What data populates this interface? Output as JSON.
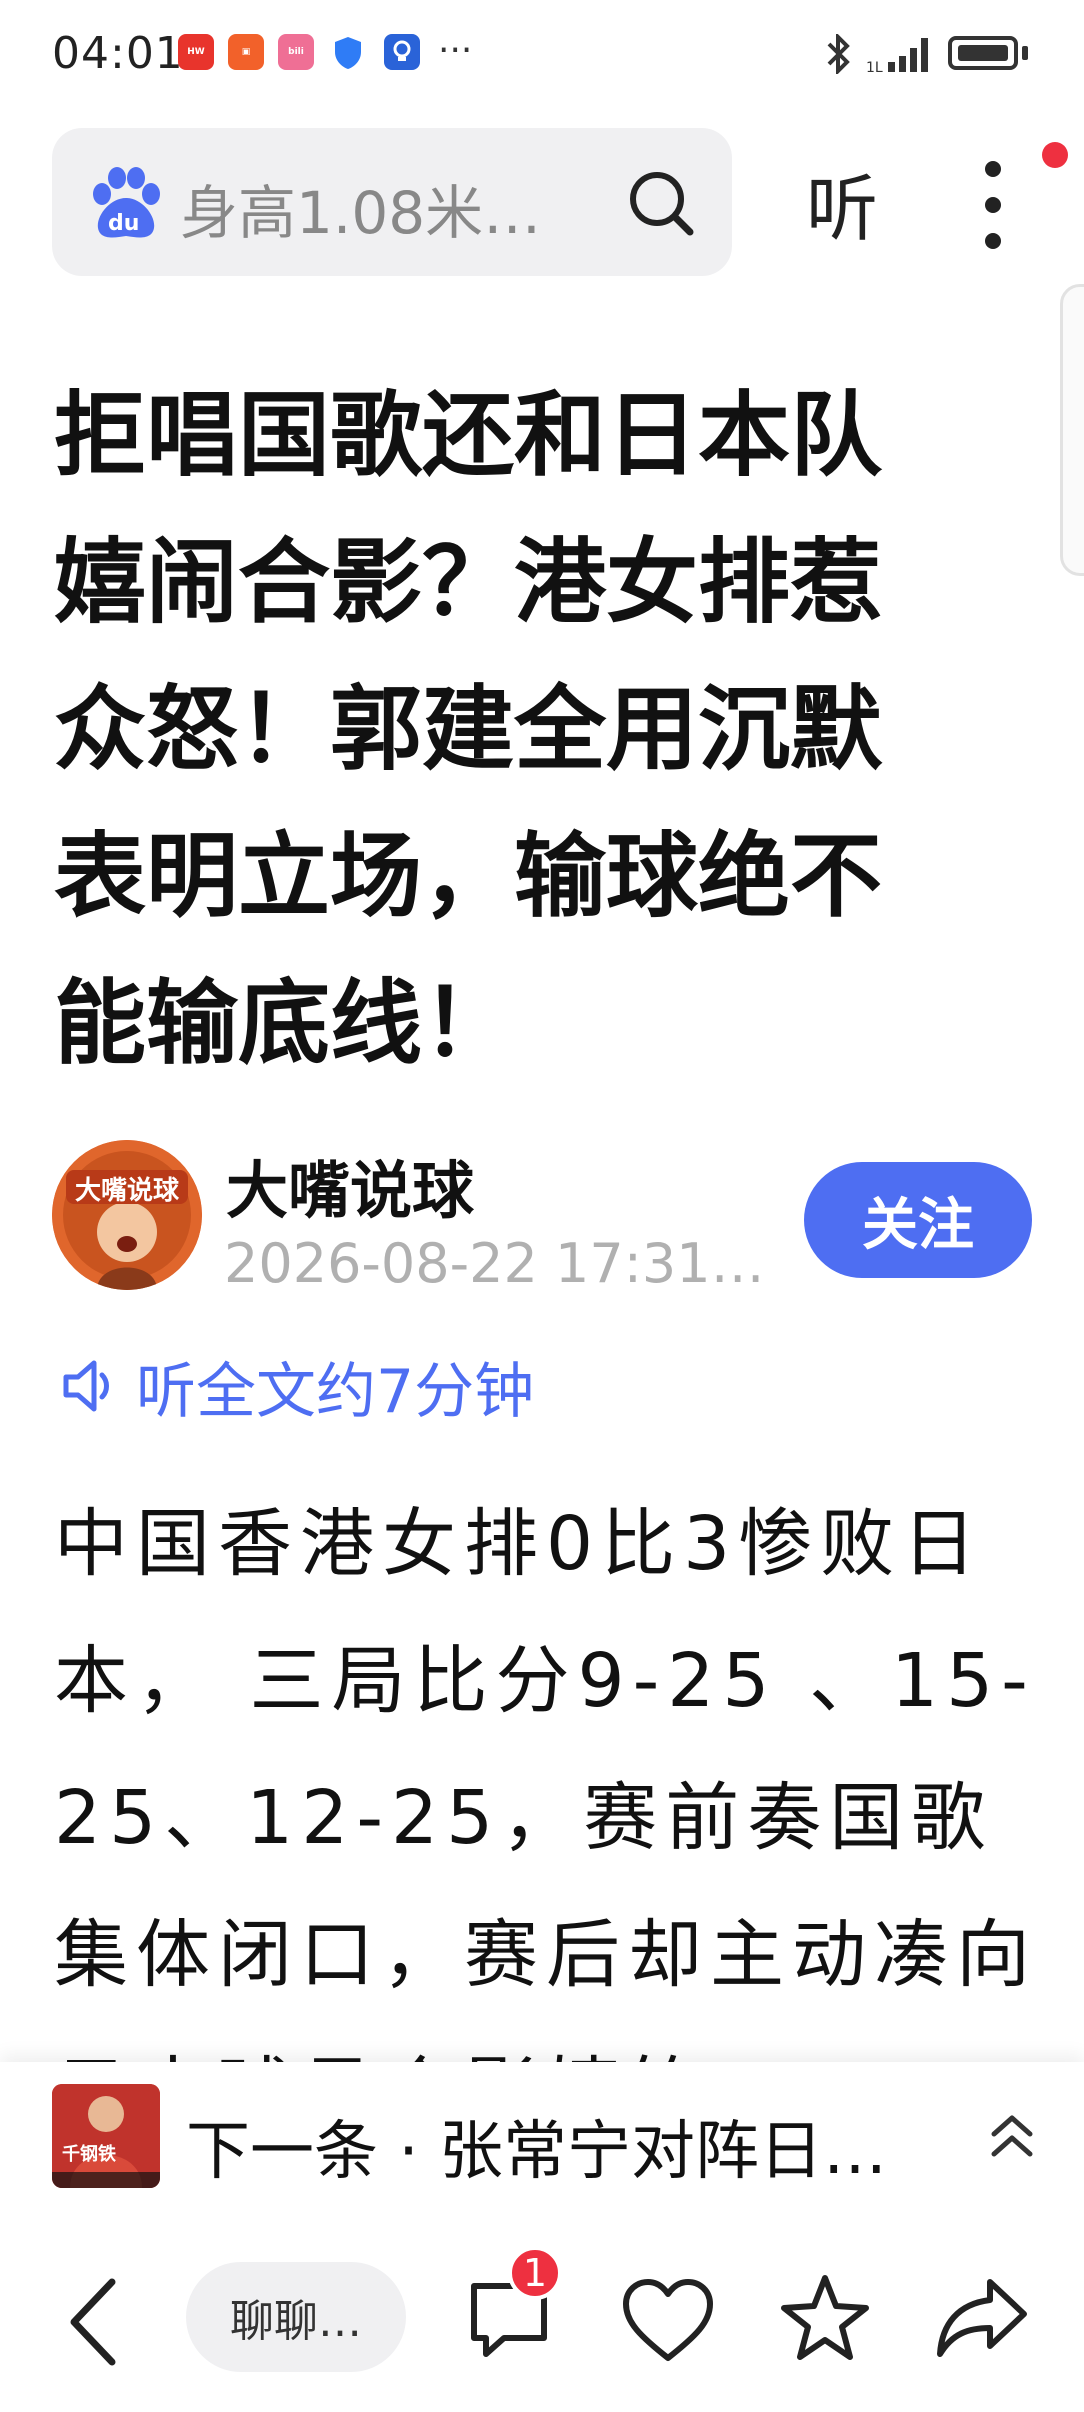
{
  "status_bar": {
    "time": "04:01",
    "app_icons": [
      {
        "name": "huawei-icon",
        "label": "HUAWEI",
        "color": "#e8342c"
      },
      {
        "name": "app-orange-icon",
        "label": "",
        "color": "#f2612a"
      },
      {
        "name": "bilibili-icon",
        "label": "bilibili",
        "color": "#ef6f95"
      },
      {
        "name": "shield-icon",
        "label": "",
        "color": "#2f7cf6"
      },
      {
        "name": "bulb-icon",
        "label": "",
        "color": "#2a63d8"
      }
    ],
    "more": "···"
  },
  "search": {
    "query": "身高1.08米…",
    "listen_label": "听"
  },
  "article": {
    "title": "拒唱国歌还和日本队嬉闹合影？港女排惹众怒！郭建全用沉默表明立场，输球绝不能输底线！",
    "author": "大嘴说球",
    "avatar_text": "大嘴说球",
    "date": "2026-08-22 17:31…",
    "follow_label": "关注",
    "listen_label": "听全文约7分钟",
    "body": "中国香港女排0比3惨败日本， 三局比分9-25 、15-25、12-25，赛前奏国歌集体闭口，赛后却主动凑向日本球员合影嬉笑"
  },
  "next_bar": {
    "label": "下一条 · 张常宁对阵日…",
    "thumb_text": "千钢铁"
  },
  "bottom_bar": {
    "chat_label": "聊聊…",
    "comment_count": "1"
  },
  "colors": {
    "accent": "#4e6ef2",
    "badge_red": "#ee3040",
    "avatar_orange": "#e0662c"
  }
}
